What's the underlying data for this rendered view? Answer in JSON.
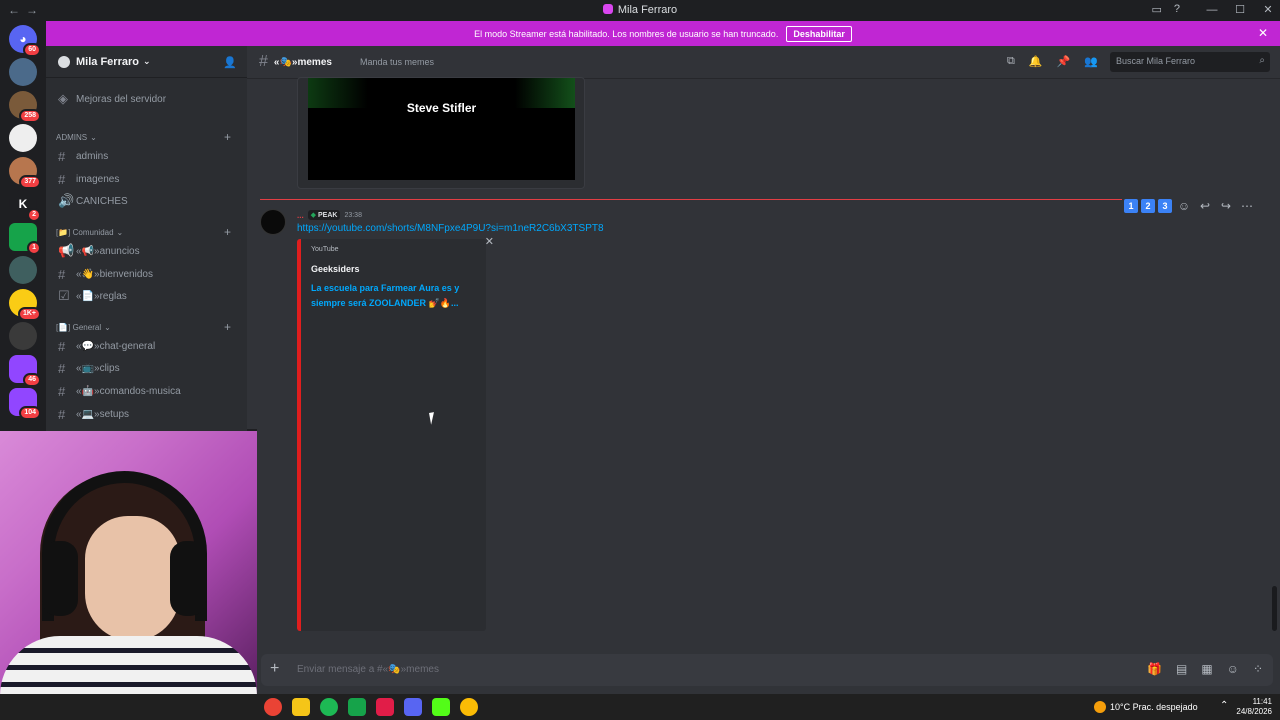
{
  "window": {
    "title": "Mila Ferraro"
  },
  "banner": {
    "message": "El modo Streamer está habilitado. Los nombres de usuario se han truncado.",
    "button": "Deshabilitar"
  },
  "rail": {
    "badges": [
      "60",
      "258",
      "377",
      "2",
      "1",
      "1K+",
      "46",
      "104"
    ],
    "letter_server": "K"
  },
  "sidebar": {
    "server_name": "Mila Ferraro",
    "items": [
      {
        "type": "channel",
        "label": "Mejoras del servidor",
        "icon": "boost-icon"
      },
      {
        "type": "category",
        "label": "ADMINS"
      },
      {
        "type": "channel",
        "label": "admins",
        "icon": "hash-icon"
      },
      {
        "type": "channel",
        "label": "imagenes",
        "icon": "hash-icon"
      },
      {
        "type": "channel",
        "label": "CANICHES",
        "icon": "speaker-icon"
      },
      {
        "type": "category",
        "label": "[📁] Comunidad"
      },
      {
        "type": "channel",
        "label": "«📢»anuncios",
        "icon": "megaphone-icon"
      },
      {
        "type": "channel",
        "label": "«👋»bienvenidos",
        "icon": "hash-icon"
      },
      {
        "type": "channel",
        "label": "«📄»reglas",
        "icon": "rules-icon"
      },
      {
        "type": "category",
        "label": "[📄] General"
      },
      {
        "type": "channel",
        "label": "«💬»chat-general",
        "icon": "hash-icon"
      },
      {
        "type": "channel",
        "label": "«📺»clips",
        "icon": "hash-icon"
      },
      {
        "type": "channel",
        "label": "«🤖»comandos-musica",
        "icon": "hash-icon"
      },
      {
        "type": "channel",
        "label": "«💻»setups",
        "icon": "hash-icon"
      }
    ]
  },
  "header": {
    "channel_name": "«🎭»memes",
    "topic": "Manda tus memes",
    "search_placeholder": "Buscar Mila Ferraro"
  },
  "messages": {
    "previous_embed_caption": "Steve Stifler",
    "author_tag": "PEAK",
    "time": "23:38",
    "link": "https://youtube.com/shorts/M8NFpxe4P9U?si=m1neR2C6bX3TSPT8",
    "embed": {
      "provider": "YouTube",
      "author": "Geeksiders",
      "title": "La escuela para Farmear Aura es y siempre será ZOOLANDER 💅🔥..."
    },
    "action_numbers": [
      "1",
      "2",
      "3"
    ]
  },
  "composer": {
    "placeholder": "Enviar mensaje a #«🎭»memes"
  },
  "taskbar": {
    "weather": "10°C  Prac. despejado",
    "time": "11:41",
    "date": "24/8/2026"
  },
  "colors": {
    "banner": "#c026d3",
    "unread_divider": "#e23e44",
    "embed_accent": "#e01e1e",
    "link": "#00a8fc"
  }
}
